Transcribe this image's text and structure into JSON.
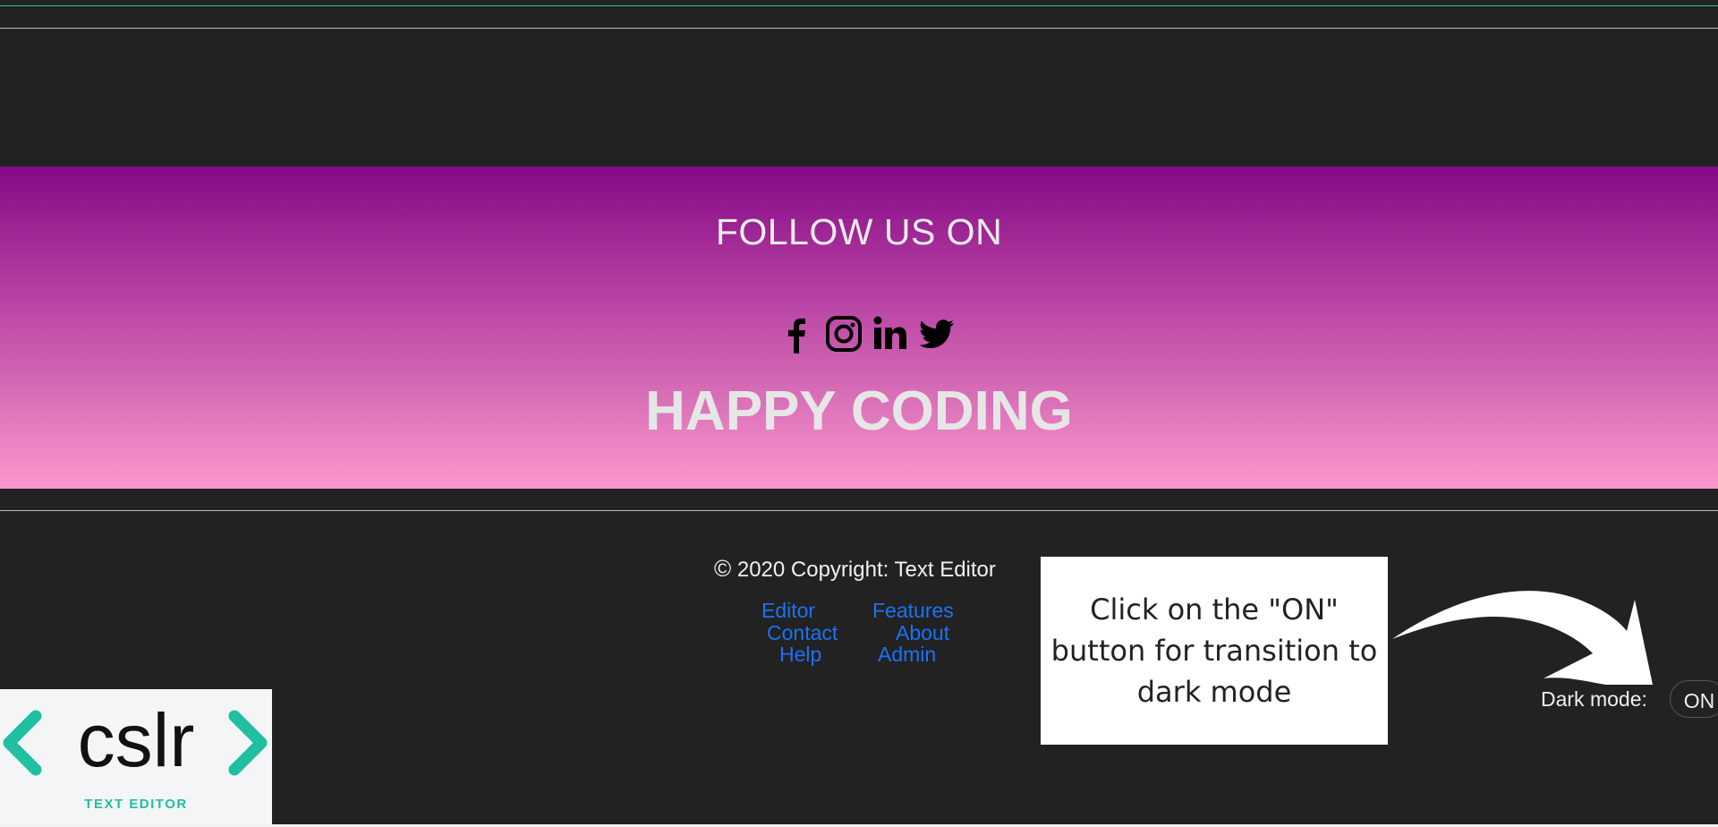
{
  "banner": {
    "follow_text": "FOLLOW US ON",
    "social_icons": [
      "facebook-icon",
      "instagram-icon",
      "linkedin-icon",
      "twitter-icon"
    ],
    "tagline": "HAPPY CODING",
    "gradient_colors": [
      "#820a85",
      "#fc98cc"
    ]
  },
  "footer": {
    "copyright_symbol": "©",
    "copyright_text": "2020 Copyright: Text Editor",
    "links": [
      "Editor",
      "Features",
      "Contact",
      "About",
      "Help",
      "Admin"
    ],
    "link_color": "#1a73f5"
  },
  "tooltip": {
    "text": "Click on the \"ON\" button for transition to dark mode"
  },
  "dark_mode": {
    "label": "Dark mode:",
    "toggle_label": "ON"
  },
  "logo": {
    "wordmark": "cslr",
    "subtitle": "TEXT EDITOR",
    "accent_color": "#1fbfa0"
  }
}
